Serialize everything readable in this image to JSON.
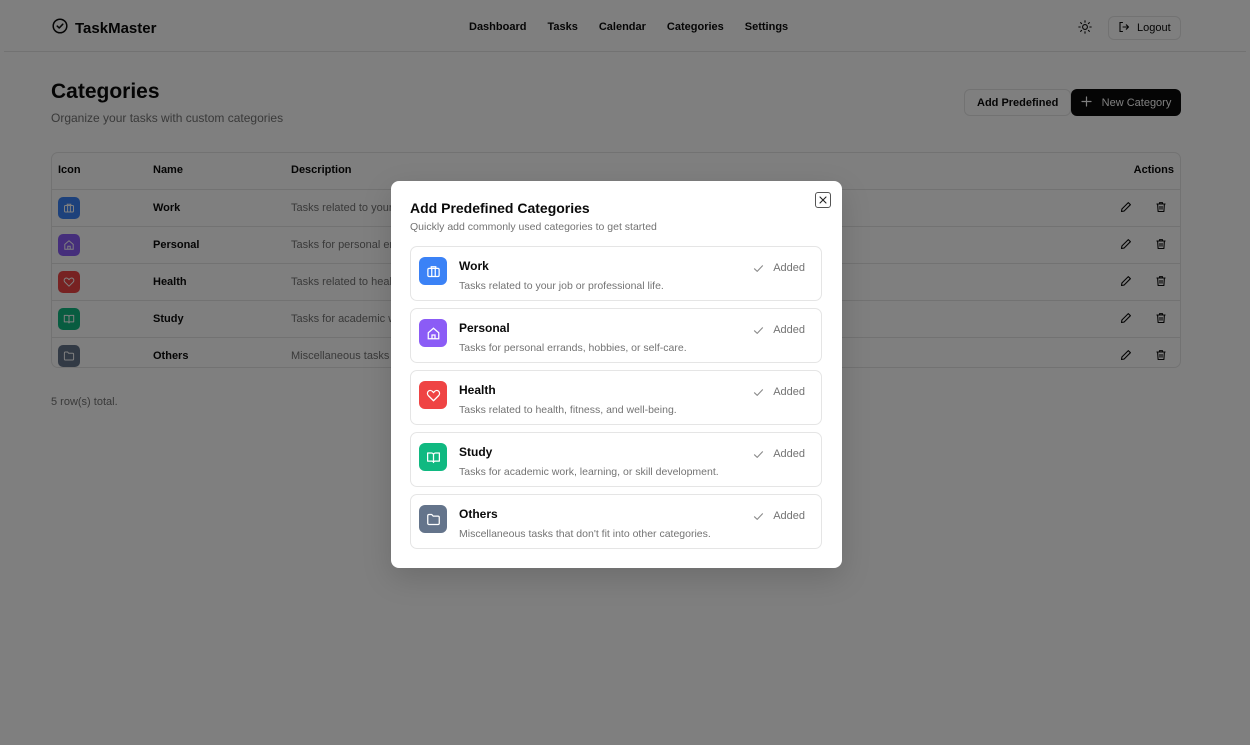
{
  "app": {
    "brand": "TaskMaster"
  },
  "nav": [
    "Dashboard",
    "Tasks",
    "Calendar",
    "Categories",
    "Settings"
  ],
  "header": {
    "logout_label": "Logout"
  },
  "page": {
    "title": "Categories",
    "subtitle": "Organize your tasks with custom categories",
    "add_predefined_label": "Add Predefined",
    "new_category_label": "New Category"
  },
  "table": {
    "headers": {
      "icon": "Icon",
      "name": "Name",
      "description": "Description",
      "actions": "Actions"
    },
    "rows": [
      {
        "name": "Work",
        "description": "Tasks related to your job or professional life.",
        "color": "#3b82f6",
        "icon": "briefcase-icon"
      },
      {
        "name": "Personal",
        "description": "Tasks for personal errands, hobbies, or self-care.",
        "color": "#8b5cf6",
        "icon": "home-icon"
      },
      {
        "name": "Health",
        "description": "Tasks related to health, fitness, and well-being.",
        "color": "#ef4444",
        "icon": "heart-icon"
      },
      {
        "name": "Study",
        "description": "Tasks for academic work, learning, or skill development.",
        "color": "#10b981",
        "icon": "book-icon"
      },
      {
        "name": "Others",
        "description": "Miscellaneous tasks that don't fit into other categories.",
        "color": "#64748b",
        "icon": "folder-icon"
      }
    ],
    "row_count_text": "5 row(s) total."
  },
  "modal": {
    "title": "Add Predefined Categories",
    "description": "Quickly add commonly used categories to get started",
    "added_label": "Added"
  }
}
